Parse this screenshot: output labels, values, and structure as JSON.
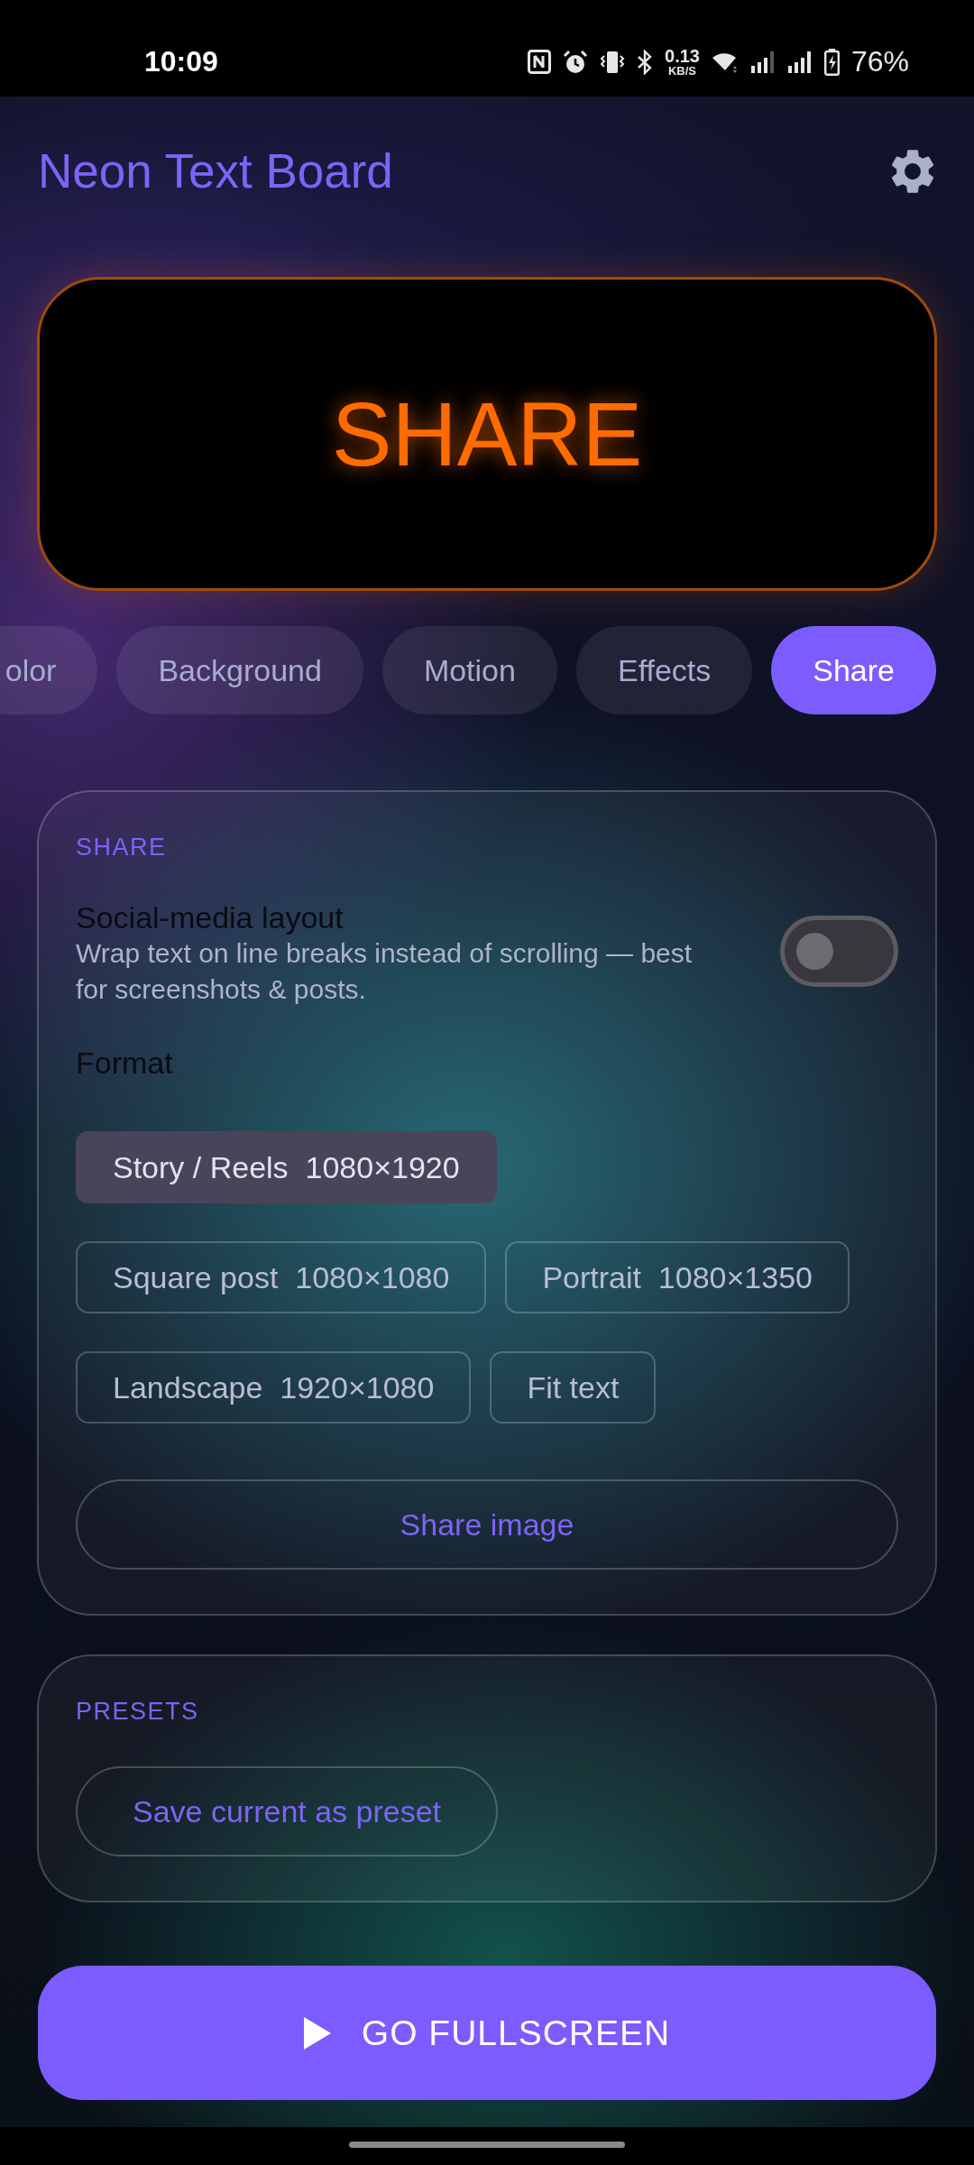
{
  "status_bar": {
    "time": "10:09",
    "net_speed": "0.13",
    "net_unit": "KB/S",
    "battery": "76%"
  },
  "header": {
    "title": "Neon Text Board"
  },
  "preview": {
    "text": "SHARE"
  },
  "tabs": [
    {
      "label": "olor",
      "selected": false
    },
    {
      "label": "Background",
      "selected": false
    },
    {
      "label": "Motion",
      "selected": false
    },
    {
      "label": "Effects",
      "selected": false
    },
    {
      "label": "Share",
      "selected": true
    }
  ],
  "share": {
    "heading": "SHARE",
    "setting": {
      "title": "Social-media layout",
      "description": "Wrap text on line breaks instead of scrolling — best for screenshots & posts.",
      "on": false
    },
    "format_label": "Format",
    "formats": [
      {
        "label": "Story / Reels  1080×1920",
        "selected": true
      },
      {
        "label": "Square post  1080×1080",
        "selected": false
      },
      {
        "label": "Portrait  1080×1350",
        "selected": false
      },
      {
        "label": "Landscape  1920×1080",
        "selected": false
      },
      {
        "label": "Fit text",
        "selected": false
      }
    ],
    "share_button": "Share image"
  },
  "presets": {
    "heading": "PRESETS",
    "save_button": "Save current as preset"
  },
  "fullscreen_button": {
    "label": "GO FULLSCREEN"
  }
}
